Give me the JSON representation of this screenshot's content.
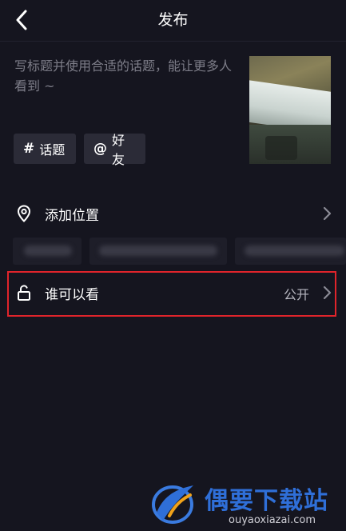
{
  "header": {
    "title": "发布",
    "back_icon": "chevron-left-icon"
  },
  "post": {
    "caption_placeholder": "写标题并使用合适的话题，能让更多人看到 ~",
    "tags": [
      {
        "symbol": "#",
        "label": "话题",
        "icon": "hashtag-icon"
      },
      {
        "symbol": "@",
        "label": "好友",
        "icon": "at-icon"
      }
    ]
  },
  "location": {
    "label": "添加位置",
    "icon": "location-pin-icon"
  },
  "visibility": {
    "label": "谁可以看",
    "value": "公开",
    "icon": "unlock-icon",
    "highlight_color": "#e0242b"
  },
  "watermark": {
    "brand": "偶要下载站",
    "url": "ouyaoxiazai.com"
  },
  "colors": {
    "background": "#15151f",
    "chip": "#2b2b37",
    "muted_text": "#7d7d88"
  }
}
